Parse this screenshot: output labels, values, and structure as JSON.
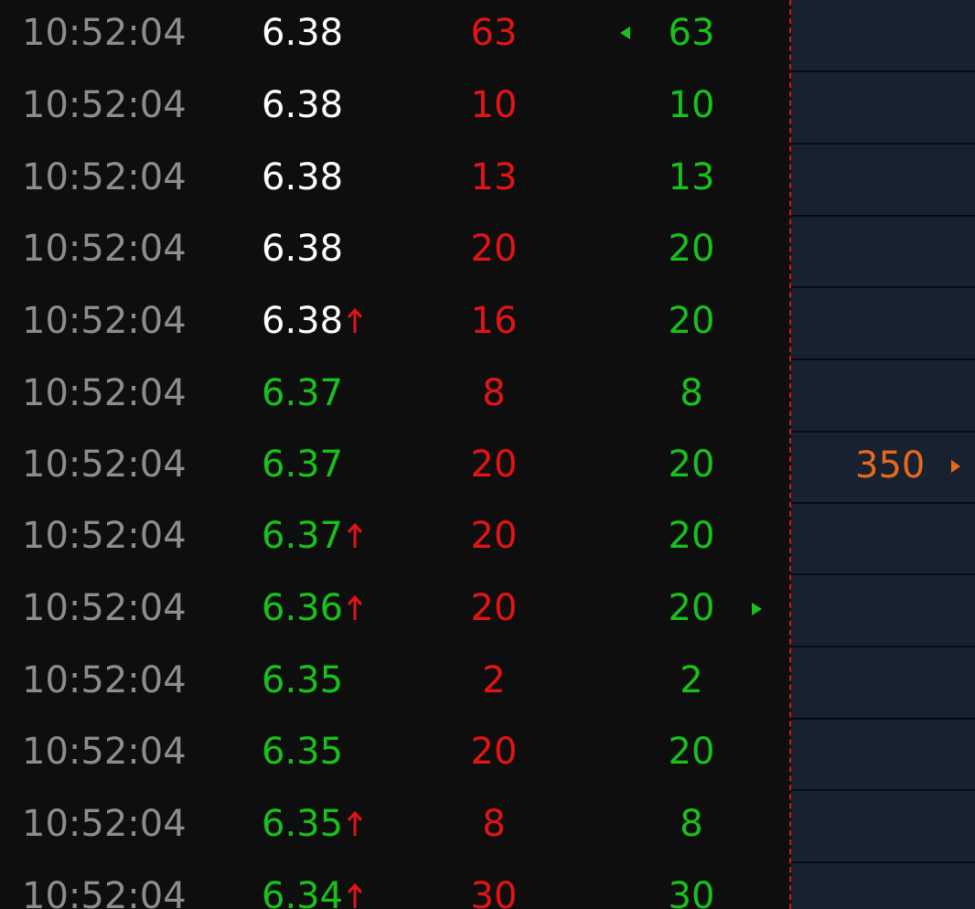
{
  "colors": {
    "background": "#0e0e0f",
    "time": "#8d8d8f",
    "price_flat": "#ffffff",
    "price_down": "#17c21a",
    "volume": "#e31414",
    "volume_alt": "#17c21a",
    "side_panel": "#172130",
    "side_accent": "#e8691c"
  },
  "ticks": [
    {
      "time": "10:52:04",
      "price": "6.38",
      "trend": "flat",
      "up_mark": false,
      "volume": "63",
      "volume2": "63"
    },
    {
      "time": "10:52:04",
      "price": "6.38",
      "trend": "flat",
      "up_mark": false,
      "volume": "10",
      "volume2": "10"
    },
    {
      "time": "10:52:04",
      "price": "6.38",
      "trend": "flat",
      "up_mark": false,
      "volume": "13",
      "volume2": "13"
    },
    {
      "time": "10:52:04",
      "price": "6.38",
      "trend": "flat",
      "up_mark": false,
      "volume": "20",
      "volume2": "20"
    },
    {
      "time": "10:52:04",
      "price": "6.38",
      "trend": "flat",
      "up_mark": true,
      "volume": "16",
      "volume2": "20"
    },
    {
      "time": "10:52:04",
      "price": "6.37",
      "trend": "down",
      "up_mark": false,
      "volume": "8",
      "volume2": "8"
    },
    {
      "time": "10:52:04",
      "price": "6.37",
      "trend": "down",
      "up_mark": false,
      "volume": "20",
      "volume2": "20"
    },
    {
      "time": "10:52:04",
      "price": "6.37",
      "trend": "down",
      "up_mark": true,
      "volume": "20",
      "volume2": "20"
    },
    {
      "time": "10:52:04",
      "price": "6.36",
      "trend": "down",
      "up_mark": true,
      "volume": "20",
      "volume2": "20"
    },
    {
      "time": "10:52:04",
      "price": "6.35",
      "trend": "down",
      "up_mark": false,
      "volume": "2",
      "volume2": "2"
    },
    {
      "time": "10:52:04",
      "price": "6.35",
      "trend": "down",
      "up_mark": false,
      "volume": "20",
      "volume2": "20"
    },
    {
      "time": "10:52:04",
      "price": "6.35",
      "trend": "down",
      "up_mark": true,
      "volume": "8",
      "volume2": "8"
    },
    {
      "time": "10:52:04",
      "price": "6.34",
      "trend": "down",
      "up_mark": true,
      "volume": "30",
      "volume2": "30"
    }
  ],
  "markers": {
    "left_pointer_icon": "triangle-left-icon",
    "right_pointer_icon": "triangle-right-icon"
  },
  "side_panel": {
    "highlight_value": "350",
    "highlight_icon": "triangle-right-icon"
  }
}
